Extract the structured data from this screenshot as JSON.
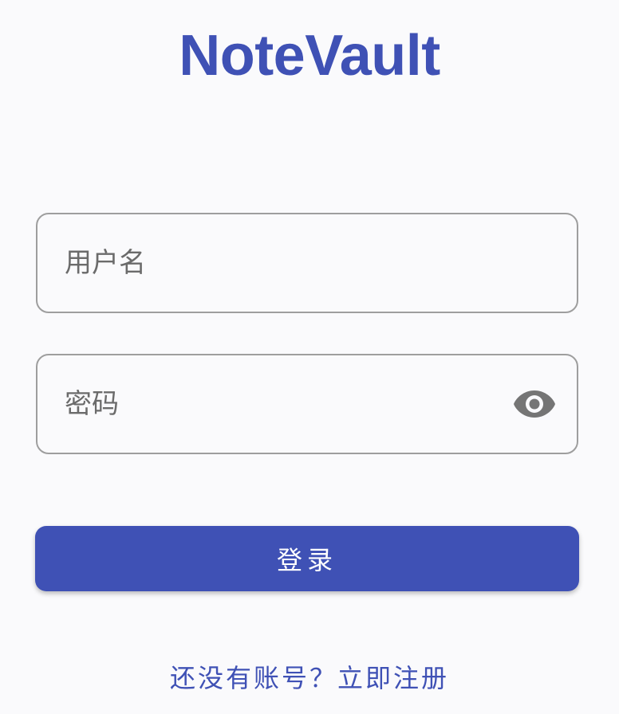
{
  "app": {
    "title": "NoteVault"
  },
  "form": {
    "username": {
      "value": "",
      "placeholder": "用户名"
    },
    "password": {
      "value": "",
      "placeholder": "密码",
      "toggle_icon": "eye-icon"
    },
    "login_label": "登录",
    "register_link_text": "还没有账号？立即注册"
  },
  "colors": {
    "primary": "#3f51b5",
    "background": "#fafafc",
    "field_border": "#9e9e9e",
    "placeholder": "#6b6b6b",
    "icon": "#757575"
  }
}
